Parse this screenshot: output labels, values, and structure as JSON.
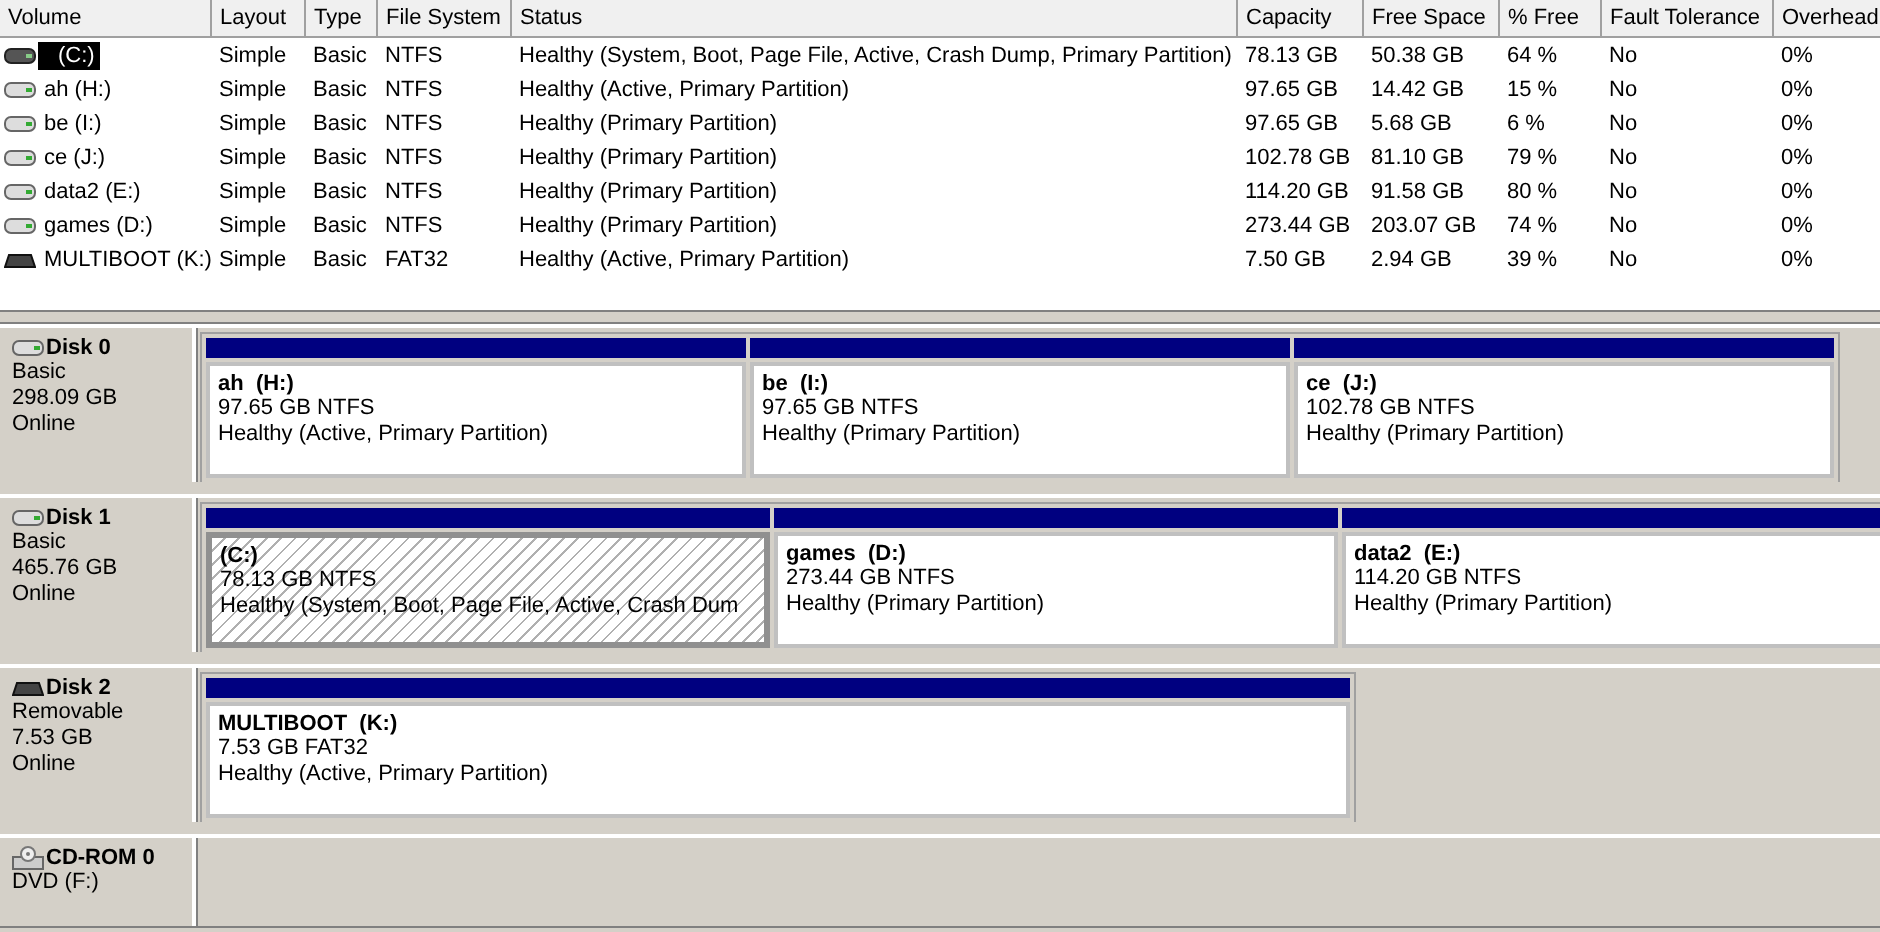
{
  "volume_list": {
    "columns": [
      "Volume",
      "Layout",
      "Type",
      "File System",
      "Status",
      "Capacity",
      "Free Space",
      "% Free",
      "Fault Tolerance",
      "Overhead"
    ],
    "rows": [
      {
        "kind": "fixed_dark",
        "selected": true,
        "cells": [
          "(C:)",
          "Simple",
          "Basic",
          "NTFS",
          "Healthy (System, Boot, Page File, Active, Crash Dump, Primary Partition)",
          "78.13 GB",
          "50.38 GB",
          "64 %",
          "No",
          "0%"
        ]
      },
      {
        "kind": "fixed",
        "selected": false,
        "cells": [
          "ah (H:)",
          "Simple",
          "Basic",
          "NTFS",
          "Healthy (Active, Primary Partition)",
          "97.65 GB",
          "14.42 GB",
          "15 %",
          "No",
          "0%"
        ]
      },
      {
        "kind": "fixed",
        "selected": false,
        "cells": [
          "be (I:)",
          "Simple",
          "Basic",
          "NTFS",
          "Healthy (Primary Partition)",
          "97.65 GB",
          "5.68 GB",
          "6 %",
          "No",
          "0%"
        ]
      },
      {
        "kind": "fixed",
        "selected": false,
        "cells": [
          "ce (J:)",
          "Simple",
          "Basic",
          "NTFS",
          "Healthy (Primary Partition)",
          "102.78 GB",
          "81.10 GB",
          "79 %",
          "No",
          "0%"
        ]
      },
      {
        "kind": "fixed",
        "selected": false,
        "cells": [
          "data2 (E:)",
          "Simple",
          "Basic",
          "NTFS",
          "Healthy (Primary Partition)",
          "114.20 GB",
          "91.58 GB",
          "80 %",
          "No",
          "0%"
        ]
      },
      {
        "kind": "fixed",
        "selected": false,
        "cells": [
          "games (D:)",
          "Simple",
          "Basic",
          "NTFS",
          "Healthy (Primary Partition)",
          "273.44 GB",
          "203.07 GB",
          "74 %",
          "No",
          "0%"
        ]
      },
      {
        "kind": "removable",
        "selected": false,
        "cells": [
          "MULTIBOOT (K:)",
          "Simple",
          "Basic",
          "FAT32",
          "Healthy (Active, Primary Partition)",
          "7.50 GB",
          "2.94 GB",
          "39 %",
          "No",
          "0%"
        ]
      }
    ]
  },
  "disks": [
    {
      "kind": "fixed",
      "name": "Disk 0",
      "details": [
        "Basic",
        "298.09 GB",
        "Online"
      ],
      "partitions": [
        {
          "name": "ah  (H:)",
          "size": "97.65 GB NTFS",
          "status": "Healthy (Active, Primary Partition)",
          "selected": false
        },
        {
          "name": "be  (I:)",
          "size": "97.65 GB NTFS",
          "status": "Healthy (Primary Partition)",
          "selected": false
        },
        {
          "name": "ce  (J:)",
          "size": "102.78 GB NTFS",
          "status": "Healthy (Primary Partition)",
          "selected": false
        }
      ]
    },
    {
      "kind": "fixed",
      "name": "Disk 1",
      "details": [
        "Basic",
        "465.76 GB",
        "Online"
      ],
      "partitions": [
        {
          "name": "(C:)",
          "size": "78.13 GB NTFS",
          "status": "Healthy (System, Boot, Page File, Active, Crash Dum",
          "selected": true
        },
        {
          "name": "games  (D:)",
          "size": "273.44 GB NTFS",
          "status": "Healthy (Primary Partition)",
          "selected": false
        },
        {
          "name": "data2  (E:)",
          "size": "114.20 GB NTFS",
          "status": "Healthy (Primary Partition)",
          "selected": false
        }
      ]
    },
    {
      "kind": "removable",
      "name": "Disk 2",
      "details": [
        "Removable",
        "7.53 GB",
        "Online"
      ],
      "partitions": [
        {
          "name": "MULTIBOOT  (K:)",
          "size": "7.53 GB FAT32",
          "status": "Healthy (Active, Primary Partition)",
          "selected": false
        }
      ]
    },
    {
      "kind": "cdrom",
      "name": "CD-ROM 0",
      "details": [
        "DVD (F:)"
      ]
    }
  ]
}
